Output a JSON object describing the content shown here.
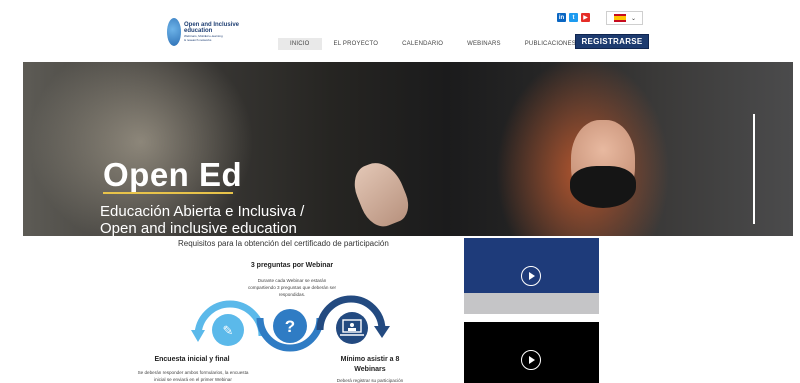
{
  "header": {
    "logo": {
      "title_line1": "Open and Inclusive",
      "title_line2": "education",
      "sub_line1": "Webinars, MobiEd e-learning",
      "sub_line2": "& research networks"
    },
    "social_icons": [
      "linkedin-icon",
      "twitter-icon",
      "youtube-icon"
    ],
    "language": {
      "flag": "spain-flag-icon",
      "chevron": "⌄"
    },
    "nav": [
      {
        "label": "INICIO",
        "active": true
      },
      {
        "label": "EL PROYECTO",
        "active": false
      },
      {
        "label": "CALENDARIO",
        "active": false
      },
      {
        "label": "WEBINARS",
        "active": false
      },
      {
        "label": "PUBLICACIONES",
        "active": false
      }
    ],
    "register_label": "REGISTRARSE"
  },
  "hero": {
    "title": "Open Ed",
    "subtitle_line1": "Educación Abierta e Inclusiva /",
    "subtitle_line2": "Open and inclusive education"
  },
  "requirements": {
    "title": "Requisitos para la obtención del certificado de participación",
    "steps": [
      {
        "title": "Encuesta inicial y final",
        "desc": "Se deberán responder ambos formularios, la encuesta inicial se enviará en el primer Webinar",
        "icon": "pencil-icon"
      },
      {
        "title": "3 preguntas por Webinar",
        "desc": "Durante cada Webinar se estarán compartiendo 3 preguntas que deberán ser respondidas.",
        "icon": "question-icon"
      },
      {
        "title": "Mínimo asistir a 8 Webinars",
        "desc": "Deberá registrar su participación",
        "icon": "screen-presentation-icon"
      }
    ],
    "icon_symbols": {
      "pencil": "✎",
      "question": "?"
    }
  },
  "colors": {
    "brand_navy": "#1d3b6f",
    "diagram_light_blue": "#5bb9ea",
    "diagram_mid_blue": "#2f7cc4",
    "diagram_dark_blue": "#234a80",
    "hero_underline": "#e8c34a",
    "video_blue": "#1e3b7a"
  },
  "videos": [
    {
      "name": "video-1",
      "icon": "play-icon"
    },
    {
      "name": "video-2",
      "icon": "play-icon"
    }
  ]
}
